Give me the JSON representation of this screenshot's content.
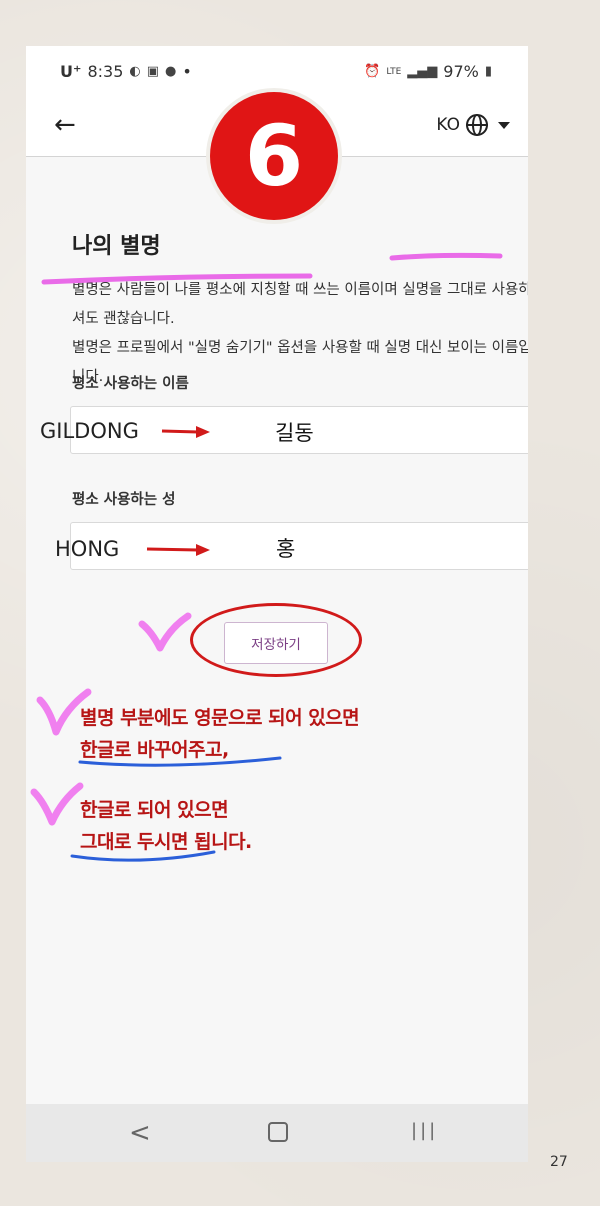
{
  "status_bar": {
    "carrier": "U⁺",
    "time": "8:35",
    "indicators": "•",
    "network": "LTE",
    "battery": "97%"
  },
  "app_bar": {
    "back_icon": "arrow-left-icon",
    "language": "KO"
  },
  "badge": {
    "number": "6"
  },
  "page": {
    "title": "나의 별명",
    "description_line1": "별명은 사람들이 나를 평소에 지칭할 때 쓰는 이름이며 실명을 그대로 사용하셔도 괜찮습니다.",
    "description_line2": "별명은 프로필에서 \"실명 숨기기\" 옵션을 사용할 때 실명 대신 보이는 이름입니다."
  },
  "form": {
    "first_name_label": "평소 사용하는 이름",
    "first_name_value": "길동",
    "last_name_label": "평소 사용하는 성",
    "last_name_value": "홍",
    "save_label": "저장하기"
  },
  "annotations": {
    "first_name_english": "GILDONG",
    "last_name_english": "HONG",
    "note1_line1": "별명 부분에도 영문으로 되어 있으면",
    "note1_line2": "한글로 바꾸어주고,",
    "note2_line1": "한글로 되어 있으면",
    "note2_line2": "그대로 두시면 됩니다."
  },
  "nav_bar": {
    "back": "<",
    "recent": "|||"
  },
  "page_number": "27",
  "colors": {
    "accent_red": "#d11a1a",
    "note_red": "#b71515",
    "highlight_pink": "#e96be8",
    "underline_blue": "#2b5fd9",
    "button_text": "#7b3f85"
  }
}
